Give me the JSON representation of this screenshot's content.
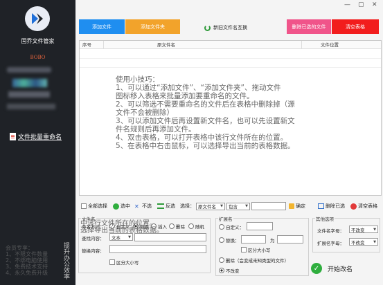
{
  "sidebar": {
    "app_title": "固乔文件管家",
    "user": "BOBO",
    "nav_item": "文件批量重命名",
    "promo_lines": [
      "会员专享：",
      "1、不限文件数量",
      "2、不绑电脑使用",
      "3、免费技术支持",
      "4、永久免费升级"
    ],
    "vertical_text": "提升办公效率"
  },
  "window": {
    "min": "—",
    "max": "▢",
    "close": "✕"
  },
  "topbar": {
    "add_file": "添加文件",
    "add_folder": "添加文件夹",
    "reset_names": "新旧文件名互换",
    "delete_selected": "删除已选的文件",
    "clear_table": "清空表格"
  },
  "table": {
    "headers": [
      "序号",
      "原文件名",
      "文件位置"
    ],
    "tips": [
      "使用小技巧：",
      "1、可以通过“添加文件”、“添加文件夹”、拖动文件",
      "图标移入表格来批量添加要重命名的文件。",
      "2、可以筛选不需要重命名的文件后在表格中删除掉（源",
      "文件不会被删除）",
      "3、可以添加文件后再设置新文件名，也可以先设置新文",
      "件名规则后再添加文件。",
      "4、双击表格，可以打开表格中该行文件所在的位置。",
      "5、在表格中右击鼠标，可以选择导出当前的表格数据。"
    ]
  },
  "toolbar": {
    "select_all": "全部选择",
    "select": "选中",
    "unselect": "不选",
    "invert": "反选",
    "choose_label": "选择：",
    "choose_field": "原文件名",
    "choose_op": "包含",
    "confirm": "确定",
    "delete_selected": "删除已选",
    "clear_table": "清空表格"
  },
  "filename_group": {
    "title": "文件名",
    "rule_label": "命名方式：",
    "rule_options": [
      "自定义",
      "替换",
      "插入",
      "删除",
      "随机"
    ],
    "rule_selected": "替换",
    "find_label": "查找内容：",
    "find_type": "文本",
    "replace_label": "替换内容：",
    "case_label": "区分大小写",
    "ghost_lines": [
      "中该行文件所在的位置。",
      "选择导出当前的表格数据。"
    ]
  },
  "ext_group": {
    "title": "扩展名",
    "custom": "自定义：",
    "replace": "替换：",
    "to": "为",
    "case_label": "区分大小写",
    "remove_label": "删除（会变成未知类型的文件）",
    "unchanged": "不改变"
  },
  "other_group": {
    "title": "其他选项",
    "filename_case_label": "文件名字母：",
    "filename_case_value": "不改变",
    "ext_case_label": "扩展名字母：",
    "ext_case_value": "不改变"
  },
  "start_button": "开始改名"
}
